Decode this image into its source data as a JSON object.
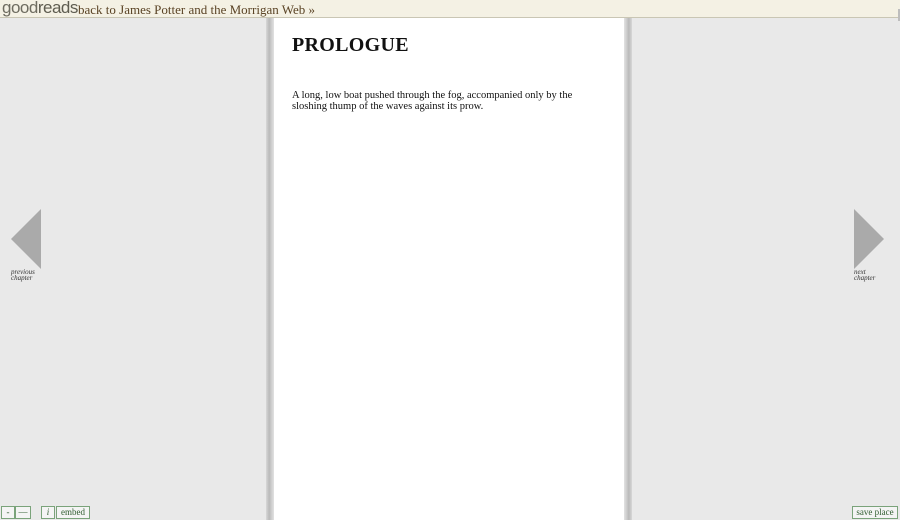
{
  "topbar": {
    "logo_good": "good",
    "logo_reads": "reads",
    "back_link": "back to James Potter and the Morrigan Web »"
  },
  "page": {
    "chapter_title": "PROLOGUE",
    "text": "A long, low boat pushed through the fog, accompanied only by the sloshing thump of the waves against its prow."
  },
  "nav": {
    "prev_line1": "previous",
    "prev_line2": "chapter",
    "next_line1": "next",
    "next_line2": "chapter"
  },
  "controls": {
    "minus": "-",
    "dash": "—",
    "info": "i",
    "embed": "embed",
    "save_place": "save place"
  },
  "colors": {
    "background": "#e9e9e9",
    "page": "#ffffff",
    "topbar": "#f4f1e4",
    "link": "#5a4325",
    "arrow": "#aaaaaa",
    "button_border": "#7aa37a"
  }
}
